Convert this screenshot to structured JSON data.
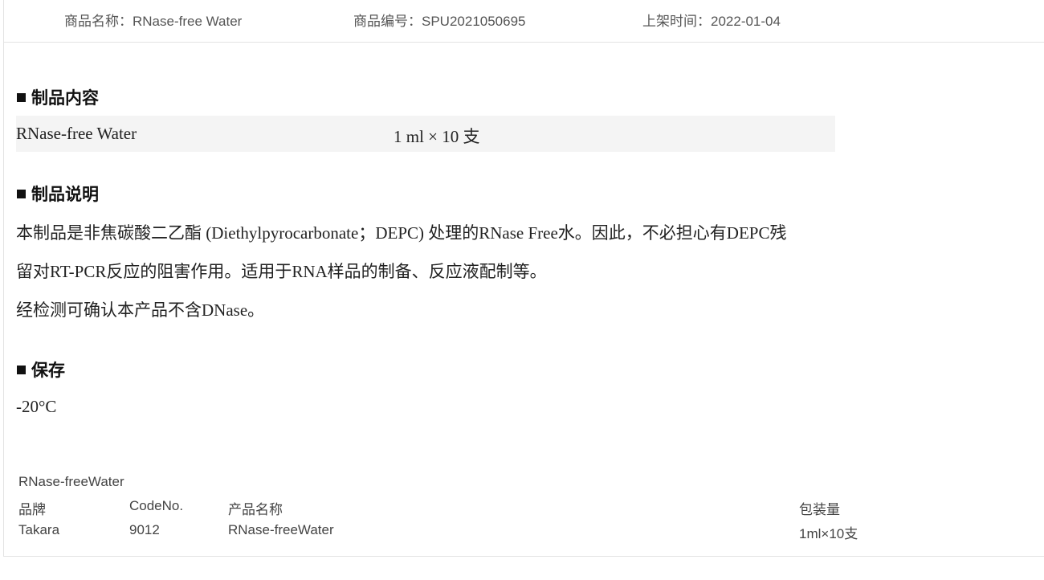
{
  "meta": {
    "name_label": "商品名称：RNase-free Water",
    "code_label": "商品编号：SPU2021050695",
    "date_label": "上架时间：2022-01-04"
  },
  "sections": {
    "contents": {
      "heading": "制品内容",
      "item_name": "RNase-free Water",
      "item_qty": "1 ml × 10 支"
    },
    "description": {
      "heading": "制品说明",
      "lines": [
        "本制品是非焦碳酸二乙酯 (Diethylpyrocarbonate；DEPC) 处理的RNase Free水。因此，不必担心有DEPC残",
        "留对RT-PCR反应的阻害作用。适用于RNA样品的制备、反应液配制等。",
        "经检测可确认本产品不含DNase。"
      ]
    },
    "storage": {
      "heading": "保存",
      "value": "-20°C"
    }
  },
  "spec_table": {
    "title": "RNase-freeWater",
    "headers": [
      "品牌",
      "CodeNo.",
      "产品名称",
      "包装量"
    ],
    "rows": [
      [
        "Takara",
        "9012",
        "RNase-freeWater",
        "1ml×10支"
      ]
    ]
  }
}
